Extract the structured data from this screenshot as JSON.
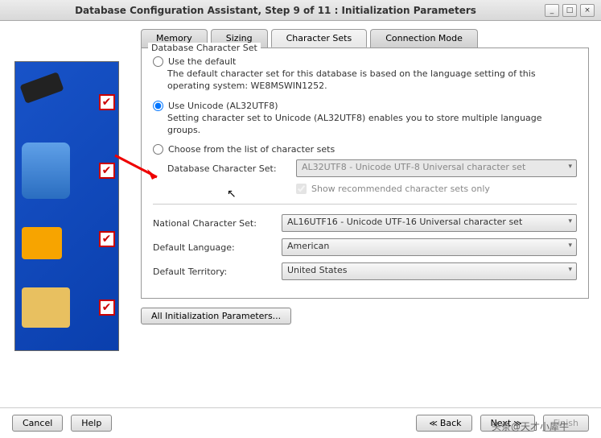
{
  "window": {
    "title": "Database Configuration Assistant, Step 9 of 11 : Initialization Parameters"
  },
  "tabs": {
    "memory": "Memory",
    "sizing": "Sizing",
    "charsets": "Character Sets",
    "connmode": "Connection Mode"
  },
  "fieldset_legend": "Database Character Set",
  "opt_default": {
    "label": "Use the default",
    "desc": "The default character set for this database is based on the language setting of this operating system: WE8MSWIN1252."
  },
  "opt_unicode": {
    "label": "Use Unicode (AL32UTF8)",
    "desc": "Setting character set to Unicode (AL32UTF8) enables you to store multiple language groups."
  },
  "opt_choose": {
    "label": "Choose from the list of character sets",
    "field_label": "Database Character Set:",
    "field_value": "AL32UTF8 - Unicode UTF-8 Universal character set",
    "checkbox": "Show recommended character sets only"
  },
  "national": {
    "label": "National Character Set:",
    "value": "AL16UTF16 - Unicode UTF-16 Universal character set"
  },
  "language": {
    "label": "Default Language:",
    "value": "American"
  },
  "territory": {
    "label": "Default Territory:",
    "value": "United States"
  },
  "all_params_btn": "All Initialization Parameters...",
  "footer": {
    "cancel": "Cancel",
    "help": "Help",
    "back": "Back",
    "next": "Next",
    "finish": "Finish"
  },
  "watermark": "头条@天才小犀牛"
}
